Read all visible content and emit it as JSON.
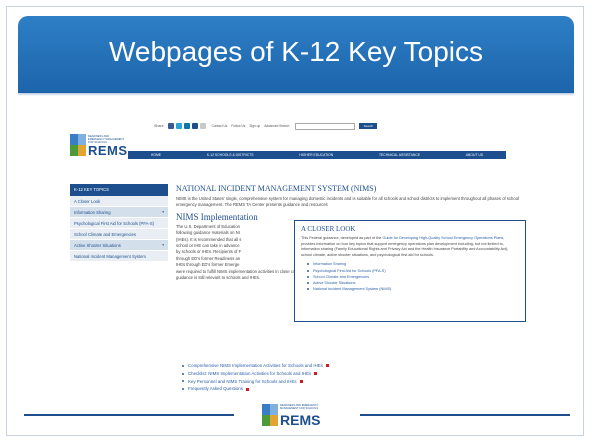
{
  "slide": {
    "title": "Webpages of K-12 Key Topics"
  },
  "topbar": {
    "share_label": "Share",
    "social_icons": [
      {
        "name": "facebook-icon",
        "color": "#3b5998",
        "glyph": "f"
      },
      {
        "name": "twitter-icon",
        "color": "#2aa3d8",
        "glyph": "t"
      },
      {
        "name": "linkedin-icon",
        "color": "#0e76a8",
        "glyph": "in"
      },
      {
        "name": "email-icon",
        "color": "#1d4f8e",
        "glyph": "✉"
      },
      {
        "name": "print-icon",
        "color": "#c9c9c9",
        "glyph": ""
      }
    ],
    "links": [
      "Contact Us",
      "Follow Us",
      "Sign up",
      "Advanced Search"
    ],
    "search_button": "Search"
  },
  "logo": {
    "small_text": "READINESS AND EMERGENCY MANAGEMENT FOR SCHOOLS",
    "text": "REMS"
  },
  "navbar": {
    "items": [
      "HOME",
      "K-12 SCHOOLS & DISTRICTS",
      "HIGHER EDUCATION",
      "TECHNICAL ASSISTANCE",
      "ABOUT US"
    ]
  },
  "sidebar": {
    "heading": "K-12 KEY TOPICS",
    "items": [
      {
        "label": "A Closer Look",
        "arrow": ""
      },
      {
        "label": "Information Sharing",
        "arrow": "▾"
      },
      {
        "label": "Psychological First Aid for Schools (PFA-S)",
        "arrow": ""
      },
      {
        "label": "School Climate and Emergencies",
        "arrow": ""
      },
      {
        "label": "Active Shooter Situations",
        "arrow": "▾"
      },
      {
        "label": "National Incident Management System",
        "arrow": ""
      }
    ]
  },
  "content": {
    "title": "NATIONAL INCIDENT MANAGEMENT SYSTEM (NIMS)",
    "paragraph1": "NIMS is the United States' single, comprehensive system for managing domestic incidents and is suitable for all schools and school districts to implement throughout all phases of school emergency management. The REMS TA Center presents guidance and resources",
    "subtitle": "NIMS Implementation",
    "paragraph2_lines": [
      "The U.S. Department of Education",
      "following guidance materials on NI",
      "(IHEs). It is recommended that all s",
      "school or IHE can take in advance",
      "by schools or IHEs. Recipients of F",
      "through ED's former Readiness an",
      "IHEs through ED's former Emerge"
    ],
    "paragraph2_tail": "were required to fulfill NIMS implementation activities in close coordination with members of their local government and emergency response community. This NIMS implementation guidance is still relevant to schools and IHEs."
  },
  "links": [
    "Comprehensive NIMS Implementation Activities for Schools and IHEs",
    "Checklist: NIMS Implementation Activities for Schools and IHEs",
    "Key Personnel and NIMS Training for Schools and IHEs",
    "Frequently Asked Questions"
  ],
  "popup": {
    "title": "A CLOSER LOOK",
    "body_prefix": "This Federal guidance, developed as part of the ",
    "body_link": "Guide for Developing High-Quality School Emergency Operations Plans",
    "body_suffix": ", provides information on four key topics that support emergency operations plan development including, but not limited to, information sharing (Family Educational Rights and Privacy Act and the Health Insurance Portability and Accountability Act), school climate, active shooter situations, and psychological first aid for schools.",
    "items": [
      "Information Sharing",
      "Psychological First Aid for Schools (PFA-S)",
      "School Climate and Emergencies",
      "Active Shooter Situations",
      "National Incident Management System (NIMS)"
    ]
  },
  "colors": {
    "header_blue": "#1c64ab",
    "brand_navy": "#1d4f8e",
    "link_blue": "#2a5ea8",
    "pdf_red": "#c8201f"
  }
}
